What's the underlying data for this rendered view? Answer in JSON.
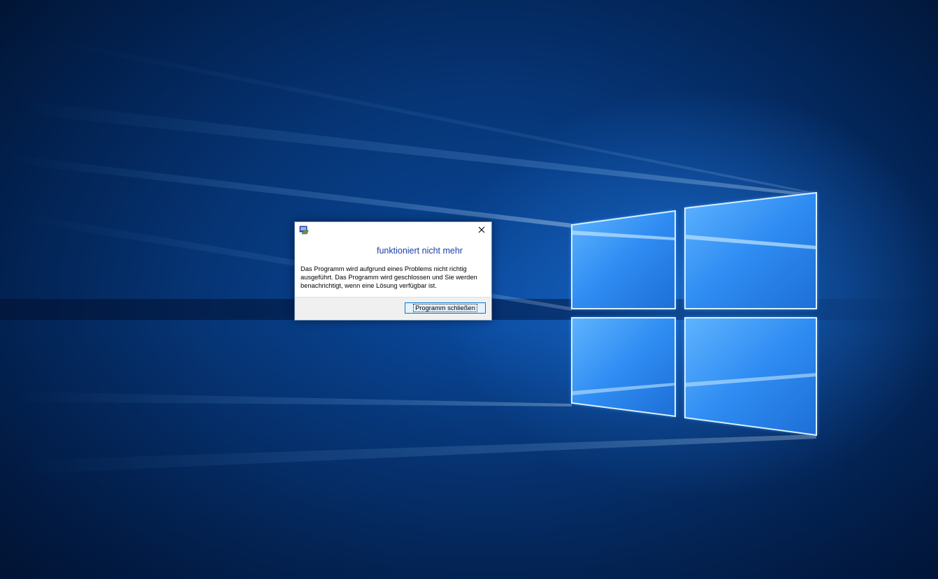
{
  "desktop": {
    "wallpaper": "windows-10-hero",
    "accent_color": "#0a4a9e"
  },
  "dialog": {
    "app_icon": "program-icon",
    "close_icon": "close-icon",
    "heading": "funktioniert nicht mehr",
    "message": "Das Programm wird aufgrund eines Problems nicht richtig ausgeführt. Das Programm wird geschlossen und Sie werden benachrichtigt, wenn eine Lösung verfügbar ist.",
    "close_program_label": "Programm schließen",
    "heading_color": "#1c3ea8",
    "button_border_color": "#0078d7"
  }
}
